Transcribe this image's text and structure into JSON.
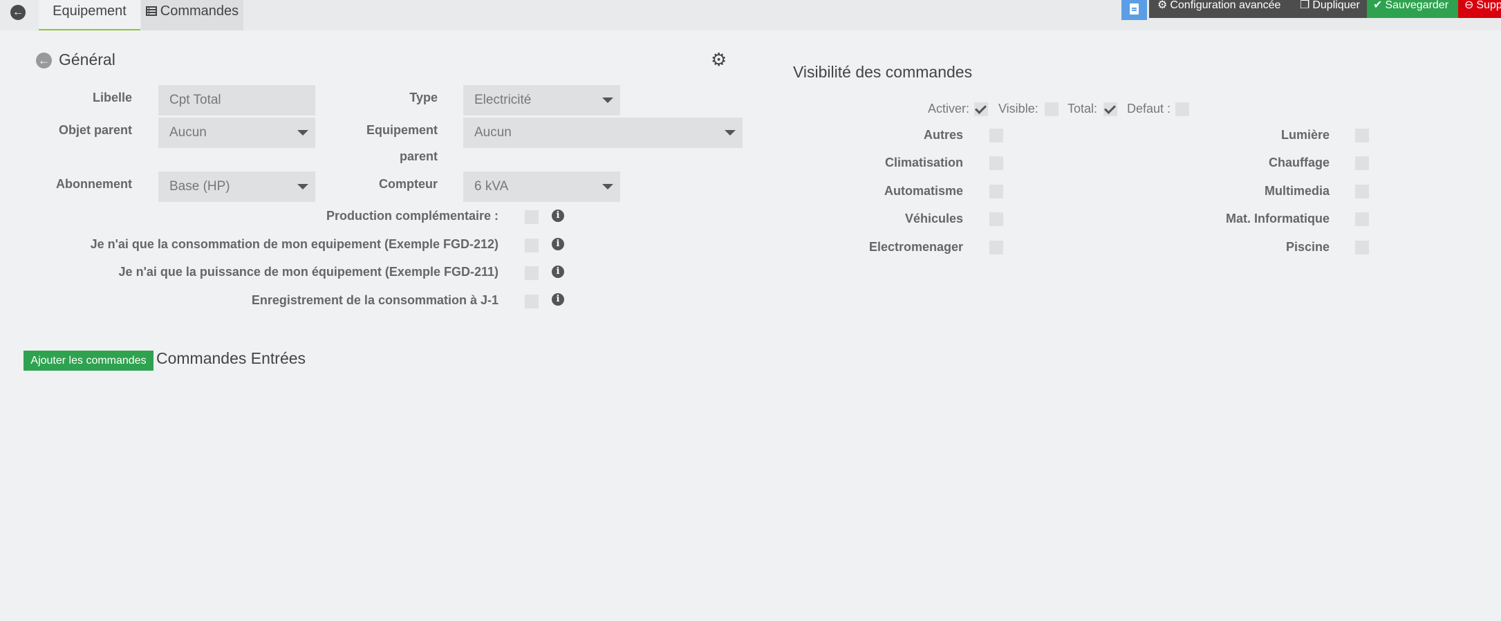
{
  "tabs": {
    "equipement": "Equipement",
    "commandes": "Commandes"
  },
  "actions": {
    "configuration": "Configuration avancée",
    "dupliquer": "Dupliquer",
    "sauvegarder": "Sauvegarder",
    "supprimer": "Supp"
  },
  "general": {
    "title": "Général",
    "fields": {
      "libelle": {
        "label": "Libelle",
        "value": "Cpt Total"
      },
      "type": {
        "label": "Type",
        "value": "Electricité"
      },
      "objet_parent": {
        "label": "Objet parent",
        "value": "Aucun"
      },
      "equipement_parent": {
        "label_line1": "Equipement",
        "label_line2": "parent",
        "value": "Aucun"
      },
      "abonnement": {
        "label": "Abonnement",
        "value": "Base (HP)"
      },
      "compteur": {
        "label": "Compteur",
        "value": "6 kVA"
      }
    },
    "options": [
      {
        "label": "Production complémentaire :",
        "checked": false
      },
      {
        "label": "Je n'ai que la consommation de mon equipement (Exemple FGD-212)",
        "checked": false
      },
      {
        "label": "Je n'ai que la puissance de mon équipement (Exemple FGD-211)",
        "checked": false
      },
      {
        "label": "Enregistrement de la consommation à J-1",
        "checked": false
      }
    ]
  },
  "commands": {
    "add_button": "Ajouter les commandes",
    "title": "Commandes Entrées"
  },
  "visibility": {
    "title": "Visibilité des commandes",
    "flags": [
      {
        "label": "Activer:",
        "checked": true
      },
      {
        "label": "Visible:",
        "checked": false
      },
      {
        "label": "Total:",
        "checked": true
      },
      {
        "label": "Defaut :",
        "checked": false
      }
    ],
    "categories_left": [
      "Autres",
      "Climatisation",
      "Automatisme",
      "Véhicules",
      "Electromenager"
    ],
    "categories_right": [
      "Lumière",
      "Chauffage",
      "Multimedia",
      "Mat. Informatique",
      "Piscine"
    ]
  }
}
